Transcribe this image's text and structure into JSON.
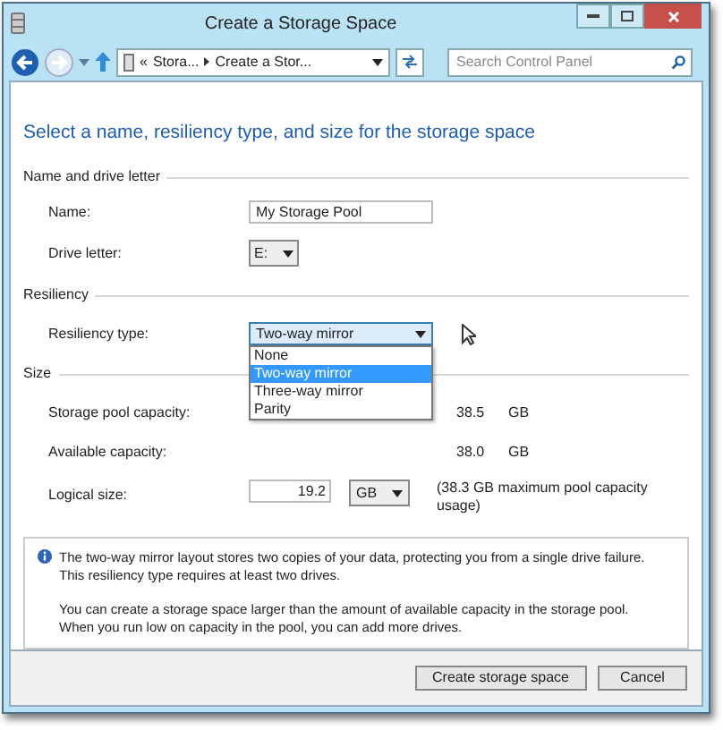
{
  "window": {
    "title": "Create a Storage Space"
  },
  "nav": {
    "breadcrumb": [
      "«",
      "Stora...",
      "Create a Stor..."
    ],
    "search": {
      "placeholder": "Search Control Panel"
    }
  },
  "heading": "Select a name, resiliency type, and size for the storage space",
  "name_section": {
    "title": "Name and drive letter",
    "name": {
      "label": "Name:",
      "value": "My Storage Pool"
    },
    "drive_letter": {
      "label": "Drive letter:",
      "value": "E:"
    }
  },
  "resiliency_section": {
    "title": "Resiliency",
    "type": {
      "label": "Resiliency type:",
      "value": "Two-way mirror",
      "expanded": true,
      "options": [
        {
          "label": "None",
          "selected": false
        },
        {
          "label": "Two-way mirror",
          "selected": true
        },
        {
          "label": "Three-way mirror",
          "selected": false
        },
        {
          "label": "Parity",
          "selected": false
        }
      ]
    }
  },
  "size_section": {
    "title": "Size",
    "rows": [
      {
        "label": "Storage pool capacity:",
        "value": "38.5",
        "unit": "GB"
      },
      {
        "label": "Available capacity:",
        "value": "38.0",
        "unit": "GB"
      }
    ],
    "logical": {
      "label": "Logical size:",
      "value": "19.2",
      "unit": "GB",
      "note": "(38.3 GB maximum pool capacity usage)"
    }
  },
  "info": [
    "The two-way mirror layout stores two copies of your data, protecting you from a single drive failure. This resiliency type requires at least two drives.",
    "You can create a storage space larger than the amount of available capacity in the storage pool. When you run low on capacity in the pool, you can add more drives."
  ],
  "buttons": [
    "Create storage space",
    "Cancel"
  ]
}
